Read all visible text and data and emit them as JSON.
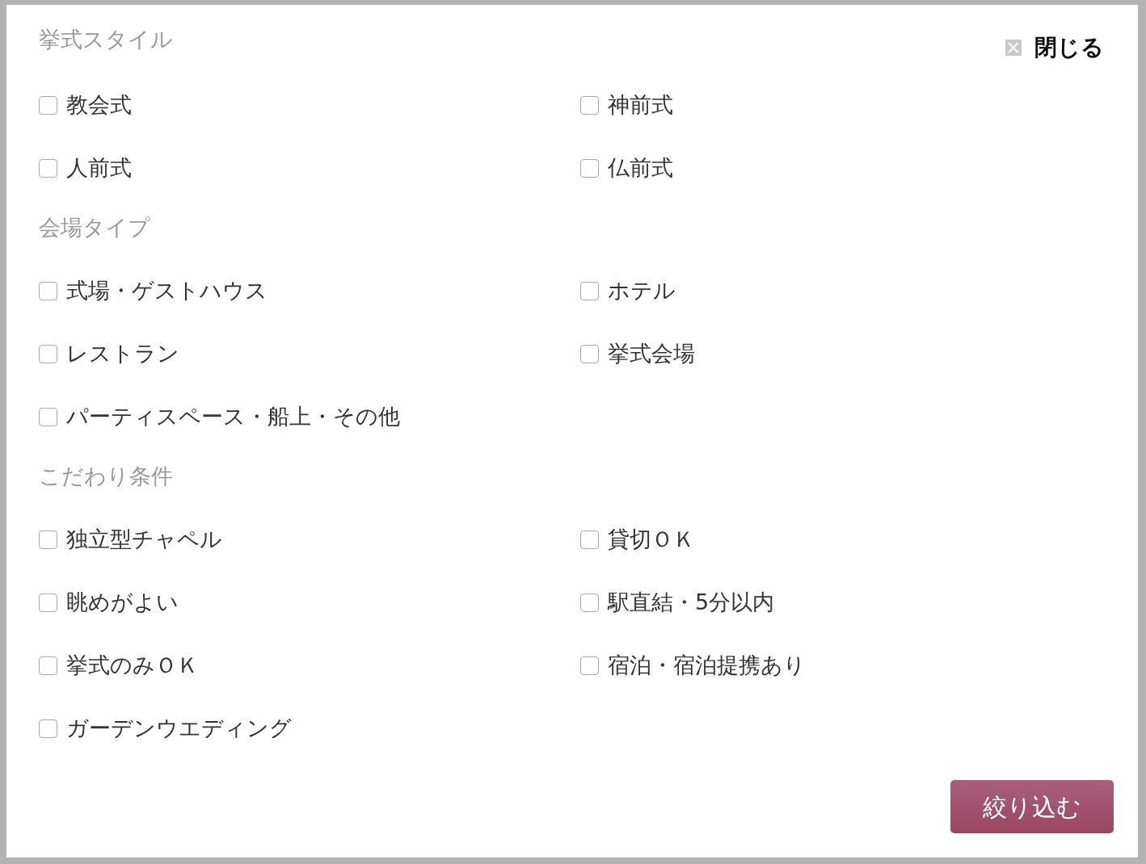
{
  "close": {
    "label": "閉じる"
  },
  "sections": [
    {
      "title": "挙式スタイル",
      "options": [
        {
          "label": "教会式",
          "checked": false
        },
        {
          "label": "神前式",
          "checked": false
        },
        {
          "label": "人前式",
          "checked": false
        },
        {
          "label": "仏前式",
          "checked": false
        }
      ]
    },
    {
      "title": "会場タイプ",
      "options": [
        {
          "label": "式場・ゲストハウス",
          "checked": false
        },
        {
          "label": "ホテル",
          "checked": false
        },
        {
          "label": "レストラン",
          "checked": false
        },
        {
          "label": "挙式会場",
          "checked": false
        },
        {
          "label": "パーティスペース・船上・その他",
          "checked": false
        }
      ]
    },
    {
      "title": "こだわり条件",
      "options": [
        {
          "label": "独立型チャペル",
          "checked": false
        },
        {
          "label": "貸切ＯＫ",
          "checked": false
        },
        {
          "label": "眺めがよい",
          "checked": false
        },
        {
          "label": "駅直結・5分以内",
          "checked": false
        },
        {
          "label": "挙式のみＯＫ",
          "checked": false
        },
        {
          "label": "宿泊・宿泊提携あり",
          "checked": false
        },
        {
          "label": "ガーデンウエディング",
          "checked": false
        }
      ]
    }
  ],
  "submit": "絞り込む"
}
